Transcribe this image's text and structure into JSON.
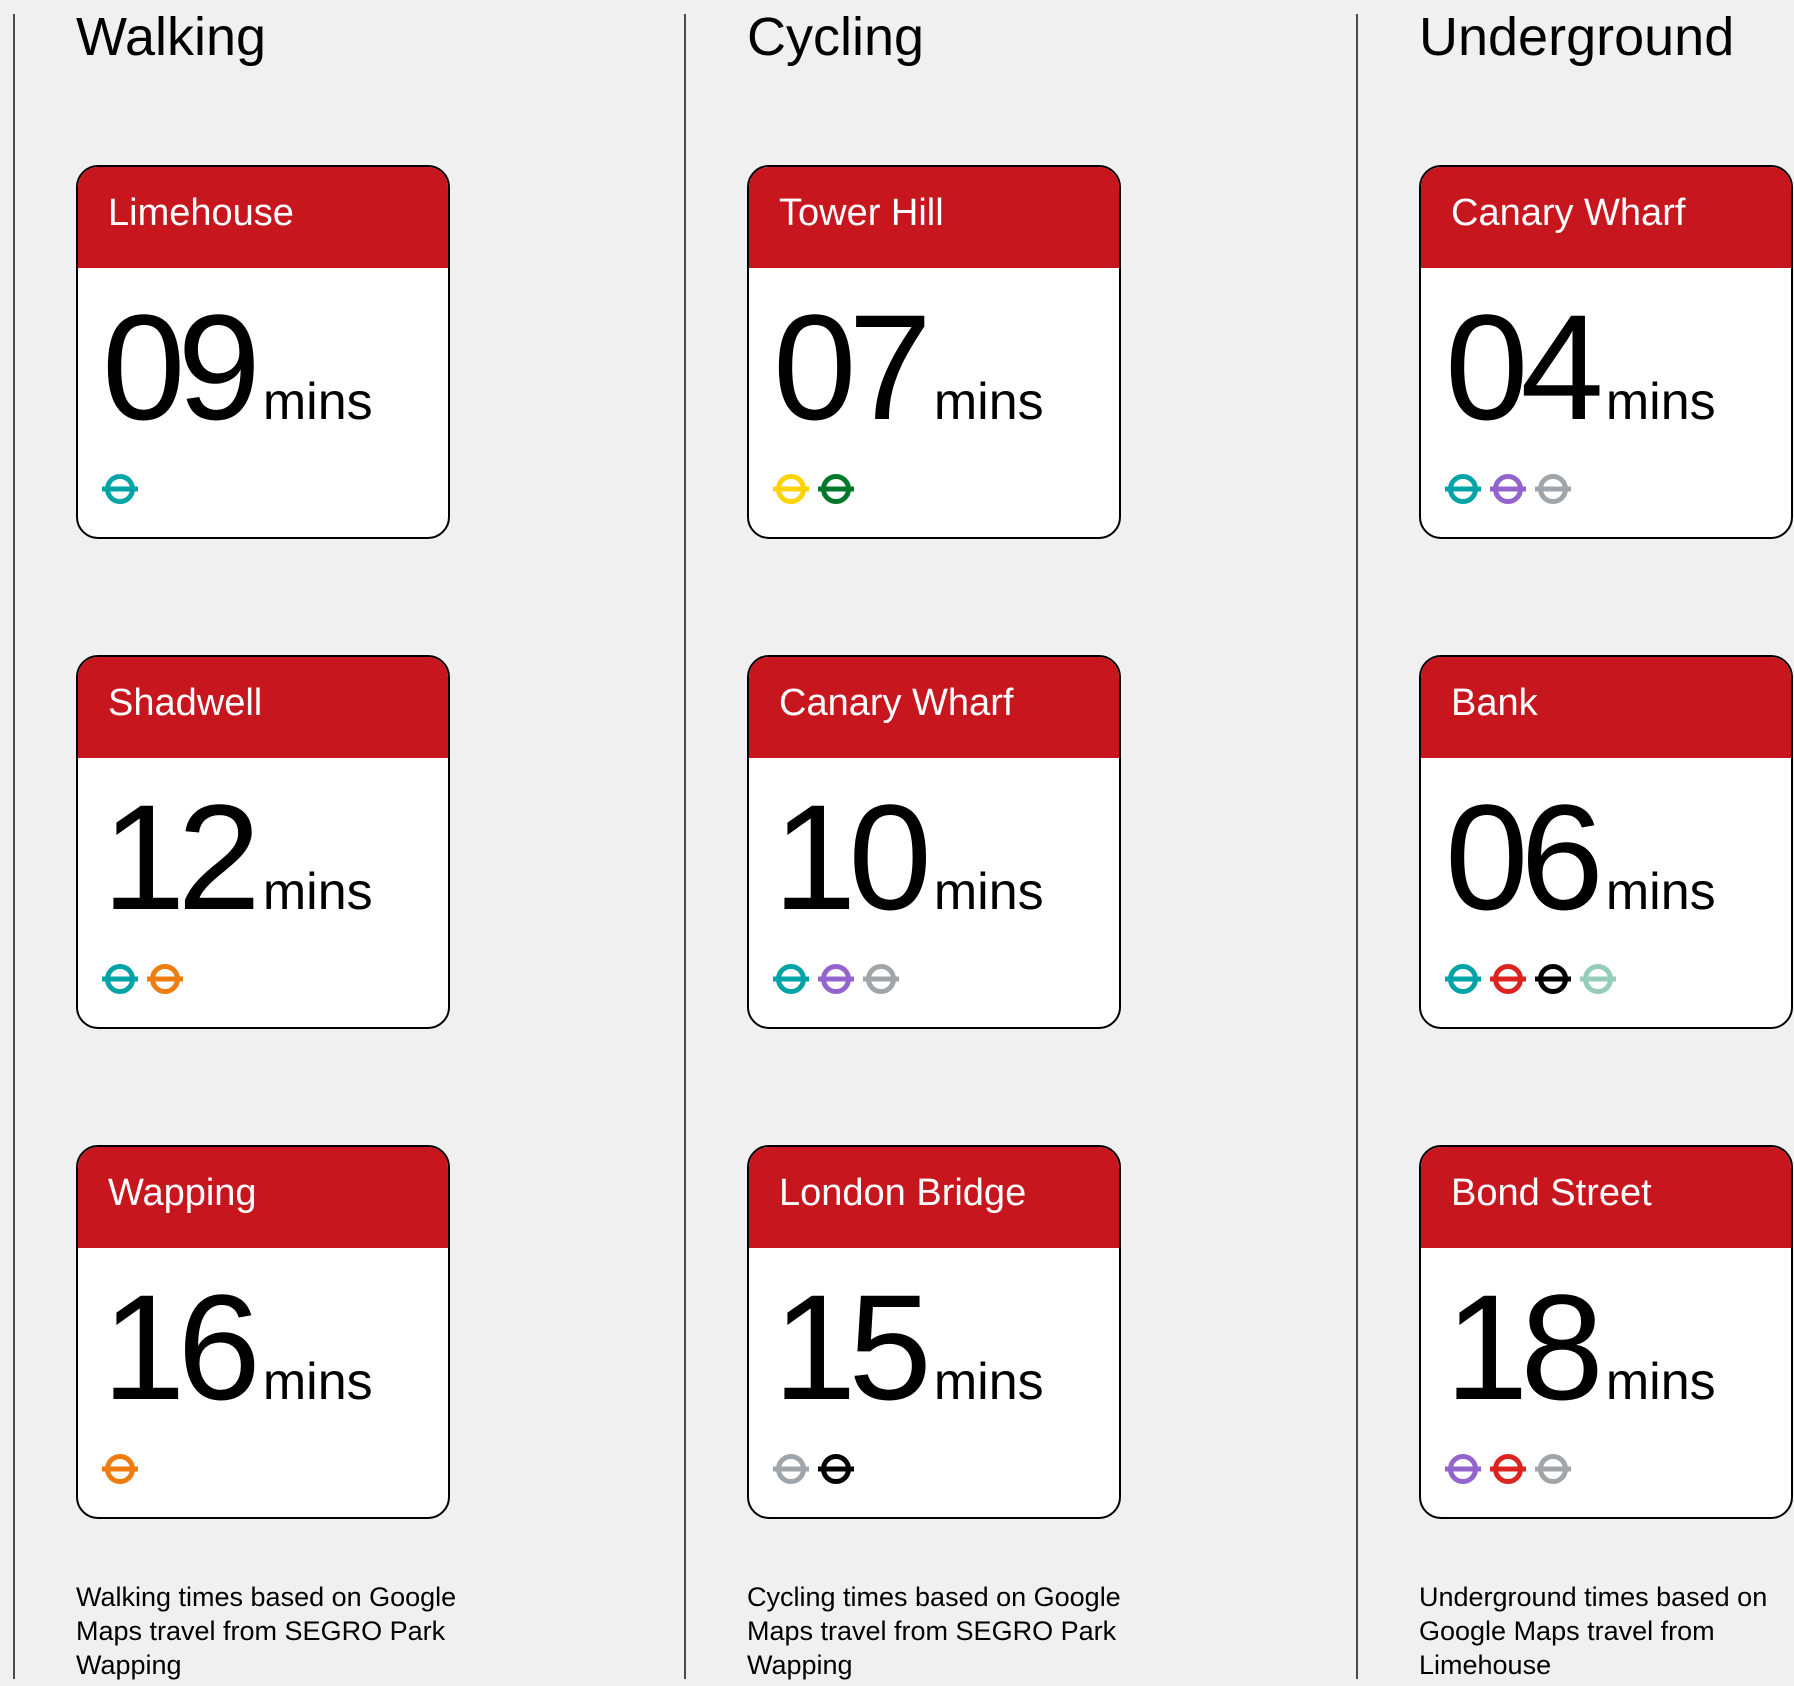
{
  "columns": [
    {
      "title": "Walking",
      "note": "Walking times based on Google Maps travel from SEGRO Park Wapping",
      "cards": [
        {
          "station": "Limehouse",
          "time": "09",
          "unit": "mins",
          "lines": [
            "dlr"
          ]
        },
        {
          "station": "Shadwell",
          "time": "12",
          "unit": "mins",
          "lines": [
            "dlr",
            "overground"
          ]
        },
        {
          "station": "Wapping",
          "time": "16",
          "unit": "mins",
          "lines": [
            "overground"
          ]
        }
      ]
    },
    {
      "title": "Cycling",
      "note": "Cycling times based on Google Maps travel from SEGRO Park Wapping",
      "cards": [
        {
          "station": "Tower Hill",
          "time": "07",
          "unit": "mins",
          "lines": [
            "circle",
            "district"
          ]
        },
        {
          "station": "Canary Wharf",
          "time": "10",
          "unit": "mins",
          "lines": [
            "dlr",
            "elizabeth",
            "jubilee"
          ]
        },
        {
          "station": "London Bridge",
          "time": "15",
          "unit": "mins",
          "lines": [
            "jubilee",
            "northern"
          ]
        }
      ]
    },
    {
      "title": "Underground",
      "note": "Underground times based on Google Maps travel from Limehouse",
      "cards": [
        {
          "station": "Canary Wharf",
          "time": "04",
          "unit": "mins",
          "lines": [
            "dlr",
            "elizabeth",
            "jubilee"
          ]
        },
        {
          "station": "Bank",
          "time": "06",
          "unit": "mins",
          "lines": [
            "dlr",
            "central",
            "northern",
            "waterloo-city"
          ]
        },
        {
          "station": "Bond Street",
          "time": "18",
          "unit": "mins",
          "lines": [
            "elizabeth",
            "central",
            "jubilee"
          ]
        }
      ]
    }
  ],
  "colors": {
    "card_header": "#c8161e",
    "dlr": "#00a4a7",
    "overground": "#ee7c0e",
    "circle": "#ffd300",
    "district": "#00782a",
    "elizabeth": "#9364cd",
    "jubilee": "#a0a5a9",
    "central": "#dc241f",
    "northern": "#000000",
    "waterloo-city": "#95cdba"
  }
}
